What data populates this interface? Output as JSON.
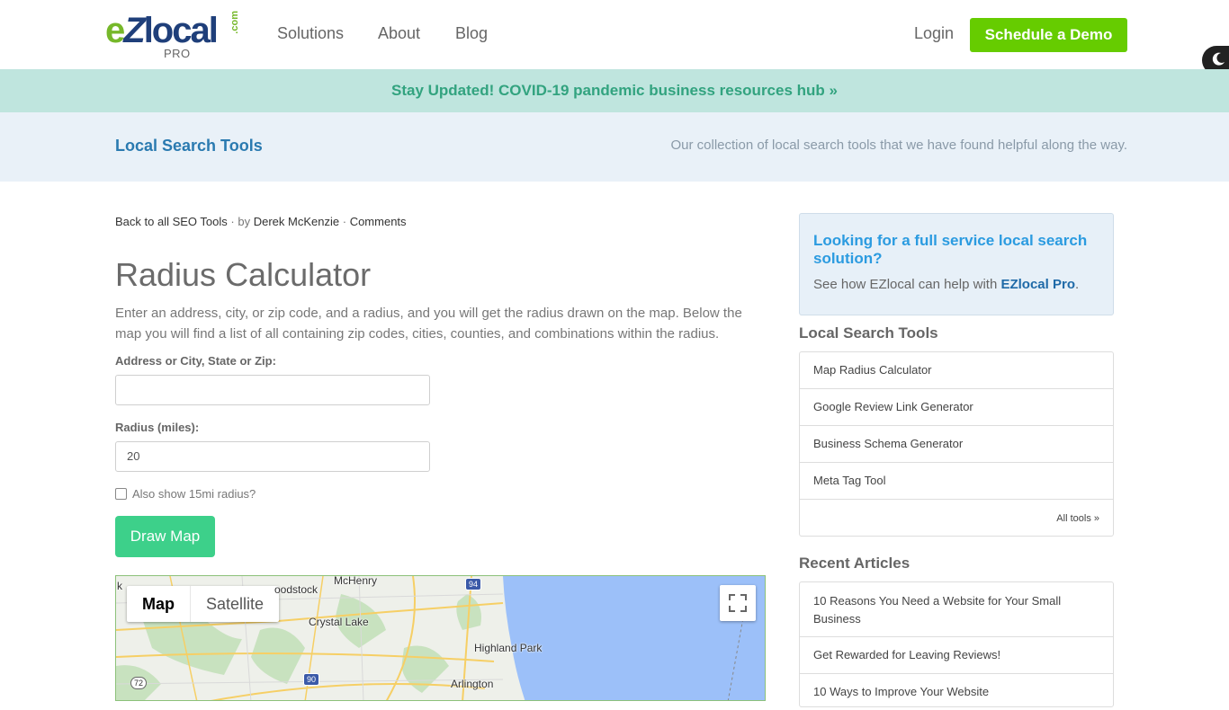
{
  "header": {
    "logo": {
      "brand": "eZlocal",
      "com": ".com",
      "sub": "PRO"
    },
    "nav": [
      "Solutions",
      "About",
      "Blog"
    ],
    "login": "Login",
    "demo_button": "Schedule a Demo"
  },
  "banner": {
    "text": "Stay Updated! COVID-19 pandemic business resources hub »"
  },
  "band": {
    "title": "Local Search Tools",
    "description": "Our collection of local search tools that we have found helpful along the way."
  },
  "breadcrumb": {
    "back": "Back to all SEO Tools",
    "sep1": "·",
    "by": "by",
    "author": "Derek McKenzie",
    "sep2": "·",
    "comments": "Comments"
  },
  "main": {
    "title": "Radius Calculator",
    "intro": "Enter an address, city, or zip code, and a radius, and you will get the radius drawn on the map. Below the map you will find a list of all containing zip codes, cities, counties, and combinations within the radius.",
    "address_label": "Address or City, State or Zip:",
    "address_value": "",
    "radius_label": "Radius (miles):",
    "radius_value": "20",
    "checkbox_label": "Also show 15mi radius?",
    "draw_button": "Draw Map"
  },
  "map": {
    "type_options": [
      "Map",
      "Satellite"
    ],
    "selected_type": "Map",
    "labels": {
      "woodstock": "oodstock",
      "mchenry": "McHenry",
      "crystal_lake": "Crystal Lake",
      "highland_park": "Highland Park",
      "arlington": "Arlington",
      "edge": "k"
    },
    "shields": {
      "i94": "94",
      "i90": "90",
      "r72": "72"
    }
  },
  "sidebar": {
    "promo": {
      "title": "Looking for a full service local search solution?",
      "text": "See how EZlocal can help with",
      "link": "EZlocal Pro",
      "period": "."
    },
    "tools_heading": "Local Search Tools",
    "tools": [
      "Map Radius Calculator",
      "Google Review Link Generator",
      "Business Schema Generator",
      "Meta Tag Tool"
    ],
    "tools_all": "All tools »",
    "articles_heading": "Recent Articles",
    "articles": [
      "10 Reasons You Need a Website for Your Small Business",
      "Get Rewarded for Leaving Reviews!",
      "10 Ways to Improve Your Website"
    ]
  },
  "colors": {
    "brand_green": "#66cc00",
    "brand_navy": "#1f3f7a",
    "banner_bg": "#bfe5de",
    "draw_button": "#3dd08a",
    "lake": "#9cc0f9"
  }
}
